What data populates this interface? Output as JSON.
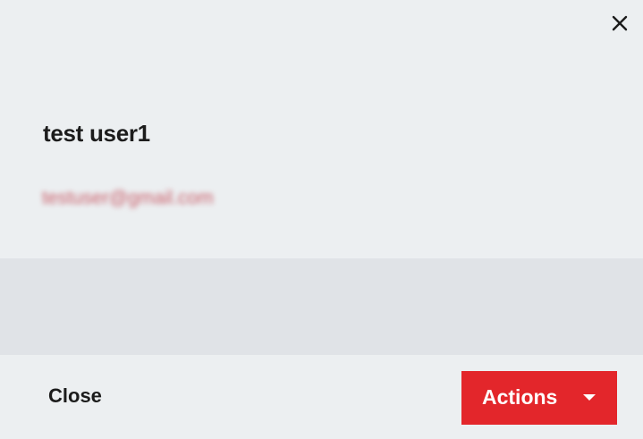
{
  "dialog": {
    "close_icon": "close-icon",
    "user": {
      "name": "test user1",
      "email": "testuser@gmail.com"
    },
    "footer": {
      "close_label": "Close",
      "actions_label": "Actions",
      "actions_icon": "caret-down-icon"
    }
  },
  "colors": {
    "background": "#eceff1",
    "band": "#e0e3e7",
    "accent": "#e3262b",
    "email": "#c9606b",
    "text": "#1c1c1c"
  }
}
